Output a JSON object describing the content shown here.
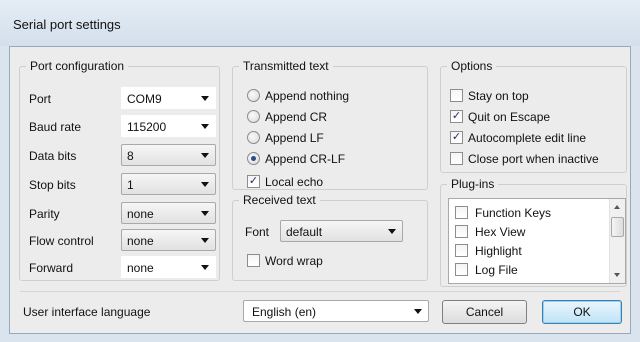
{
  "window": {
    "title": "Serial port settings"
  },
  "port_config": {
    "legend": "Port configuration",
    "fields": [
      {
        "label": "Port",
        "value": "COM9"
      },
      {
        "label": "Baud rate",
        "value": "115200"
      },
      {
        "label": "Data bits",
        "value": "8"
      },
      {
        "label": "Stop bits",
        "value": "1"
      },
      {
        "label": "Parity",
        "value": "none"
      },
      {
        "label": "Flow control",
        "value": "none"
      },
      {
        "label": "Forward",
        "value": "none"
      }
    ]
  },
  "transmitted": {
    "legend": "Transmitted text",
    "options": [
      "Append nothing",
      "Append CR",
      "Append LF",
      "Append CR-LF"
    ],
    "selected": "Append CR-LF",
    "local_echo": {
      "label": "Local echo",
      "checked": true
    }
  },
  "received": {
    "legend": "Received text",
    "font_label": "Font",
    "font_value": "default",
    "word_wrap": {
      "label": "Word wrap",
      "checked": false
    }
  },
  "options": {
    "legend": "Options",
    "items": [
      {
        "label": "Stay on top",
        "checked": false
      },
      {
        "label": "Quit on Escape",
        "checked": true
      },
      {
        "label": "Autocomplete edit line",
        "checked": true
      },
      {
        "label": "Close port when inactive",
        "checked": false
      }
    ]
  },
  "plugins": {
    "legend": "Plug-ins",
    "items": [
      {
        "label": "Function Keys",
        "checked": false
      },
      {
        "label": "Hex View",
        "checked": false
      },
      {
        "label": "Highlight",
        "checked": false
      },
      {
        "label": "Log File",
        "checked": false
      }
    ]
  },
  "language": {
    "label": "User interface language",
    "value": "English (en)"
  },
  "buttons": {
    "cancel": "Cancel",
    "ok": "OK"
  },
  "icons": {
    "check": "✓",
    "dropdown": "chevron-down-icon"
  }
}
